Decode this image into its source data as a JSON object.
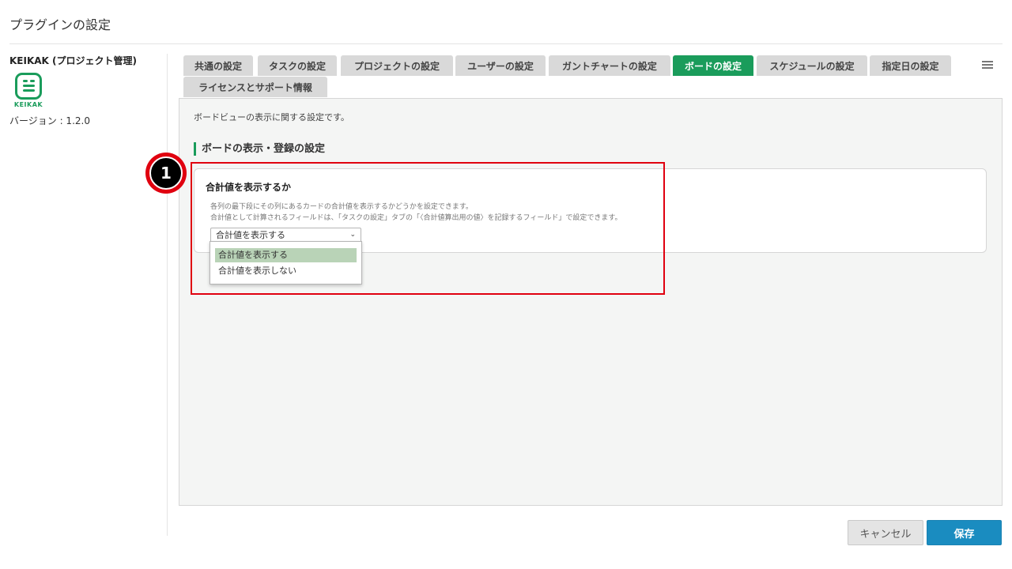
{
  "page": {
    "title": "プラグインの設定"
  },
  "sidebar": {
    "plugin_name": "KEIKAK (プロジェクト管理)",
    "logo_text": "KEIKAK",
    "version": "バージョン : 1.2.0"
  },
  "tabs": [
    {
      "label": "共通の設定",
      "active": false
    },
    {
      "label": "タスクの設定",
      "active": false
    },
    {
      "label": "プロジェクトの設定",
      "active": false
    },
    {
      "label": "ユーザーの設定",
      "active": false
    },
    {
      "label": "ガントチャートの設定",
      "active": false
    },
    {
      "label": "ボードの設定",
      "active": true
    },
    {
      "label": "スケジュールの設定",
      "active": false
    },
    {
      "label": "指定日の設定",
      "active": false
    },
    {
      "label": "ライセンスとサポート情報",
      "active": false
    }
  ],
  "panel": {
    "description": "ボードビューの表示に関する設定です。",
    "section_heading": "ボードの表示・登録の設定",
    "card": {
      "title": "合計値を表示するか",
      "help_line1": "各列の最下段にその列にあるカードの合計値を表示するかどうかを設定できます。",
      "help_line2": "合計値として計算されるフィールドは、「タスクの設定」タブの「〈合計値算出用の値〉を記録するフィールド」で設定できます。",
      "select_value": "合計値を表示する",
      "options": [
        "合計値を表示する",
        "合計値を表示しない"
      ]
    }
  },
  "annotation": {
    "badge_number": "1",
    "color": "#e0000f"
  },
  "footer": {
    "cancel_label": "キャンセル",
    "save_label": "保存"
  },
  "colors": {
    "accent": "#1a9c5b",
    "save": "#1a8cc0",
    "selected_option": "#b9d3b7"
  }
}
